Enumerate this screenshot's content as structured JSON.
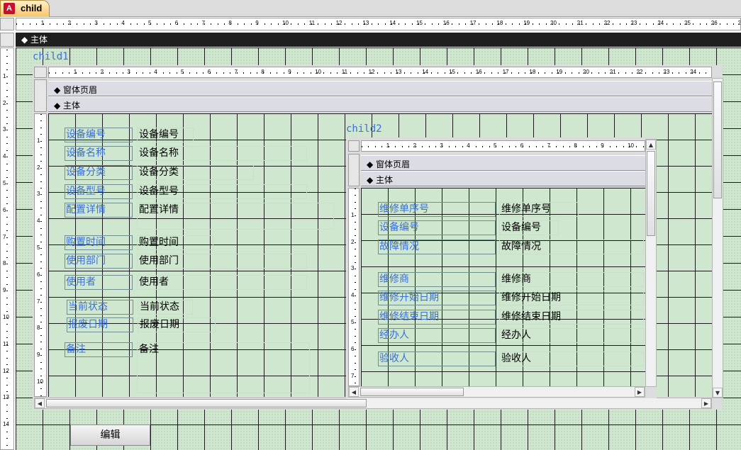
{
  "tab": {
    "title": "child",
    "icon": "access-icon",
    "icon_glyph": "A"
  },
  "outer": {
    "section_detail": "主体",
    "ruler_h_numbers": [
      "1",
      "2",
      "3",
      "4",
      "5",
      "6",
      "7",
      "8",
      "9",
      "10",
      "11",
      "12",
      "13",
      "14",
      "15",
      "16",
      "17",
      "18",
      "19",
      "20",
      "21",
      "22",
      "23",
      "24",
      "25",
      "26",
      "27"
    ],
    "ruler_v_numbers": [
      "1",
      "2",
      "3",
      "4",
      "5",
      "6",
      "7",
      "8",
      "9",
      "10",
      "11",
      "12",
      "13",
      "14"
    ]
  },
  "child1": {
    "name": "child1",
    "section_header": "窗体页眉",
    "section_detail": "主体",
    "ruler_h_numbers": [
      "1",
      "2",
      "3",
      "4",
      "5",
      "6",
      "7",
      "8",
      "9",
      "10",
      "11",
      "12",
      "13",
      "14",
      "15",
      "16",
      "17",
      "18",
      "19",
      "20",
      "21",
      "22",
      "23",
      "24"
    ],
    "ruler_v_numbers": [
      "1",
      "2",
      "3",
      "4",
      "5",
      "6",
      "7",
      "8",
      "9",
      "10"
    ],
    "fields": [
      {
        "label": "设备编号",
        "value": "设备编号"
      },
      {
        "label": "设备名称",
        "value": "设备名称"
      },
      {
        "label": "设备分类",
        "value": "设备分类"
      },
      {
        "label": "设备型号",
        "value": "设备型号"
      },
      {
        "label": "配置详情",
        "value": "配置详情"
      },
      {
        "label": "购置时间",
        "value": "购置时间"
      },
      {
        "label": "使用部门",
        "value": "使用部门"
      },
      {
        "label": "使用者",
        "value": "使用者"
      },
      {
        "label": "当前状态",
        "value": "当前状态"
      },
      {
        "label": "报废日期",
        "value": "报废日期"
      },
      {
        "label": "备注",
        "value": "备注"
      }
    ]
  },
  "child2": {
    "name": "child2",
    "section_header": "窗体页眉",
    "section_detail": "主体",
    "ruler_h_numbers": [
      "1",
      "2",
      "3",
      "4",
      "5",
      "6",
      "7",
      "8",
      "9",
      "10"
    ],
    "ruler_v_numbers": [
      "1",
      "2",
      "3",
      "4",
      "5",
      "6",
      "7"
    ],
    "fields": [
      {
        "label": "维修单序号",
        "value": "维修单序号"
      },
      {
        "label": "设备编号",
        "value": "设备编号"
      },
      {
        "label": "故障情况",
        "value": "故障情况"
      },
      {
        "label": "维修商",
        "value": "维修商"
      },
      {
        "label": "维修开始日期",
        "value": "维修开始日期"
      },
      {
        "label": "维修结束日期",
        "value": "维修结束日期"
      },
      {
        "label": "经办人",
        "value": "经办人"
      },
      {
        "label": "验收人",
        "value": "验收人"
      }
    ]
  },
  "edit_button": {
    "label": "编辑"
  },
  "colors": {
    "grid_bg": "#cfe7cf",
    "label_text": "#3a6fd6",
    "section_bar_dark": "#1e1e1e",
    "tab_accent": "#f6c46a"
  }
}
